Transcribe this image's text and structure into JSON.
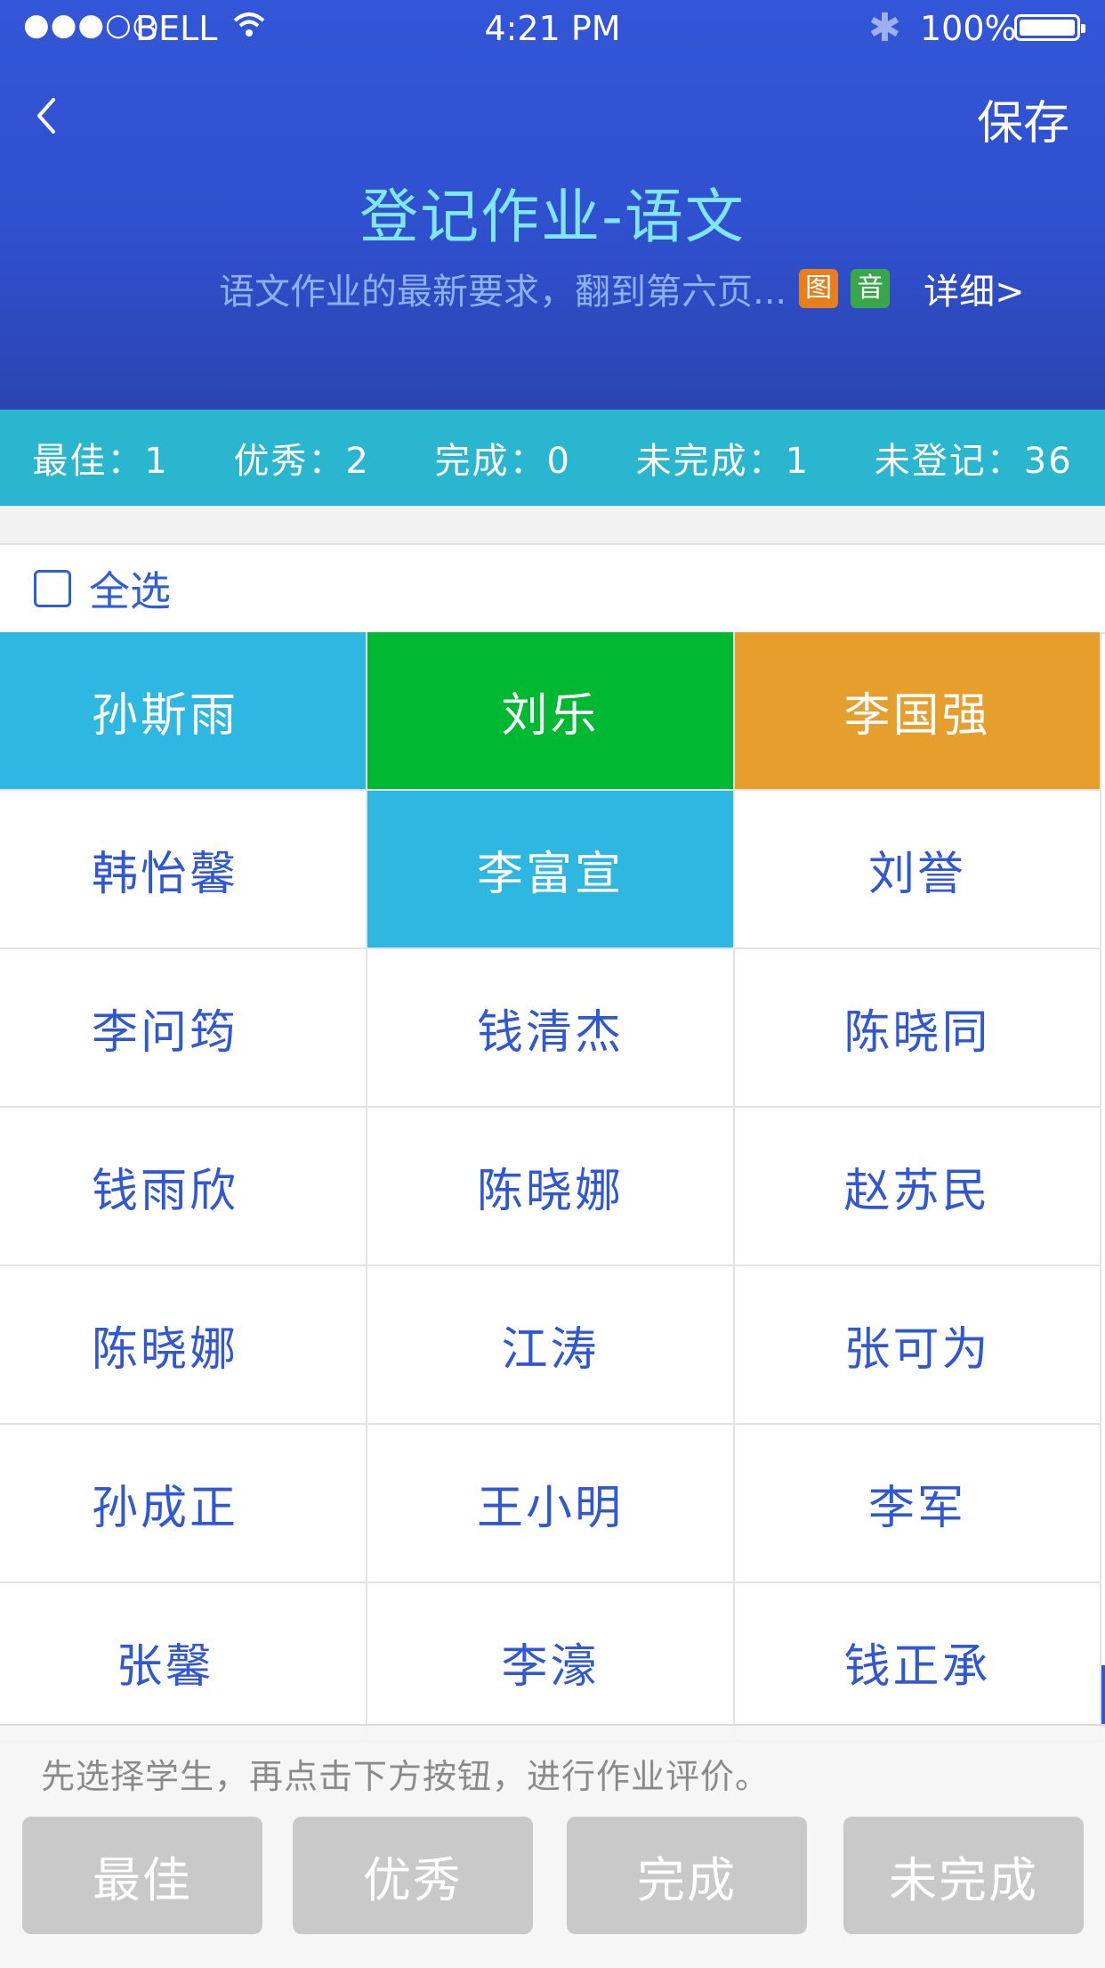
{
  "status_bar": {
    "signal": "●●●○○",
    "carrier": "BELL",
    "time": "4:21 PM",
    "battery": "100%"
  },
  "nav": {
    "save_label": "保存",
    "title": "登记作业-语文",
    "description": "语文作业的最新要求，翻到第六页...",
    "tag_image": "图",
    "tag_audio": "音",
    "detail_label": "详细>"
  },
  "stats": [
    {
      "label": "最佳：1"
    },
    {
      "label": "优秀：2"
    },
    {
      "label": "完成：0"
    },
    {
      "label": "未完成：1"
    },
    {
      "label": "未登记：36"
    }
  ],
  "select_all_label": "全选",
  "students": [
    {
      "name": "孙斯雨",
      "status": "best"
    },
    {
      "name": "刘乐",
      "status": "excellent"
    },
    {
      "name": "李国强",
      "status": "incomplete"
    },
    {
      "name": "韩怡馨",
      "status": "none"
    },
    {
      "name": "李富宣",
      "status": "best"
    },
    {
      "name": "刘誉",
      "status": "none"
    },
    {
      "name": "李问筠",
      "status": "none"
    },
    {
      "name": "钱清杰",
      "status": "none"
    },
    {
      "name": "陈晓同",
      "status": "none"
    },
    {
      "name": "钱雨欣",
      "status": "none"
    },
    {
      "name": "陈晓娜",
      "status": "none"
    },
    {
      "name": "赵苏民",
      "status": "none"
    },
    {
      "name": "陈晓娜",
      "status": "none"
    },
    {
      "name": "江涛",
      "status": "none"
    },
    {
      "name": "张可为",
      "status": "none"
    },
    {
      "name": "孙成正",
      "status": "none"
    },
    {
      "name": "王小明",
      "status": "none"
    },
    {
      "name": "李军",
      "status": "none"
    },
    {
      "name": "张馨",
      "status": "none"
    },
    {
      "name": "李濠",
      "status": "none"
    },
    {
      "name": "钱正承",
      "status": "none"
    }
  ],
  "panel": {
    "hint": "先选择学生，再点击下方按钮，进行作业评价。",
    "buttons": [
      "最佳",
      "优秀",
      "完成",
      "未完成"
    ]
  },
  "colors": {
    "header": "#3356d8",
    "stats_bar": "#2bb6cf",
    "best": "#2eb7e0",
    "excellent": "#00b831",
    "incomplete": "#e69e2c",
    "name_text": "#3158d4",
    "button_disabled": "#c9c9c9"
  }
}
